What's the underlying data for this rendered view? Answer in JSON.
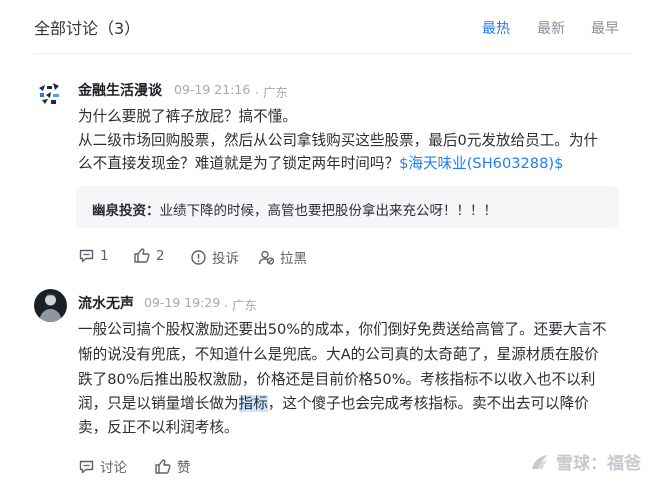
{
  "header": {
    "title": "全部讨论（3）",
    "sort_tabs": [
      {
        "label": "最热",
        "active": true
      },
      {
        "label": "最新",
        "active": false
      },
      {
        "label": "最早",
        "active": false
      }
    ]
  },
  "comments": [
    {
      "author": "金融生活漫谈",
      "time": "09-19 21:16",
      "location": "· 广东",
      "lines": [
        "为什么要脱了裤子放屁？搞不懂。",
        "从二级市场回购股票，然后从公司拿钱购买这些股票，最后0元发放给员工。为什",
        "么不直接发现金？难道就是为了锁定两年时间吗？"
      ],
      "stock_link": "$海天味业(SH603288)$",
      "reply": {
        "author": "幽泉投资：",
        "text": "业绩下降的时候，高管也要把股份拿出来充公呀！！！！"
      },
      "actions": {
        "comment_count": "1",
        "like_count": "2",
        "report": "投诉",
        "block": "拉黑"
      }
    },
    {
      "author": "流水无声",
      "time": "09-19 19:29",
      "location": "· 广东",
      "lines": [
        "一般公司搞个股权激励还要出50%的成本，你们倒好免费送给高管了。还要大言不",
        "惭的说没有兜底，不知道什么是兜底。大A的公司真的太奇葩了，星源材质在股价",
        "跌了80%后推出股权激励，价格还是目前价格50%。考核指标不以收入也不以利"
      ],
      "line4_before": "润，只是以销量增长做为",
      "line4_highlight": "指标",
      "line4_after": "，这个傻子也会完成考核指标。卖不出去可以降价",
      "line5": "卖，反正不以利润考核。",
      "actions": {
        "discuss": "讨论",
        "like": "赞"
      }
    }
  ],
  "watermark": "雪球：福爸",
  "colors": {
    "accent": "#1f7ff0",
    "text": "#2c2e33",
    "muted": "#a6a9b2",
    "quote_bg": "#f5f6f8"
  }
}
